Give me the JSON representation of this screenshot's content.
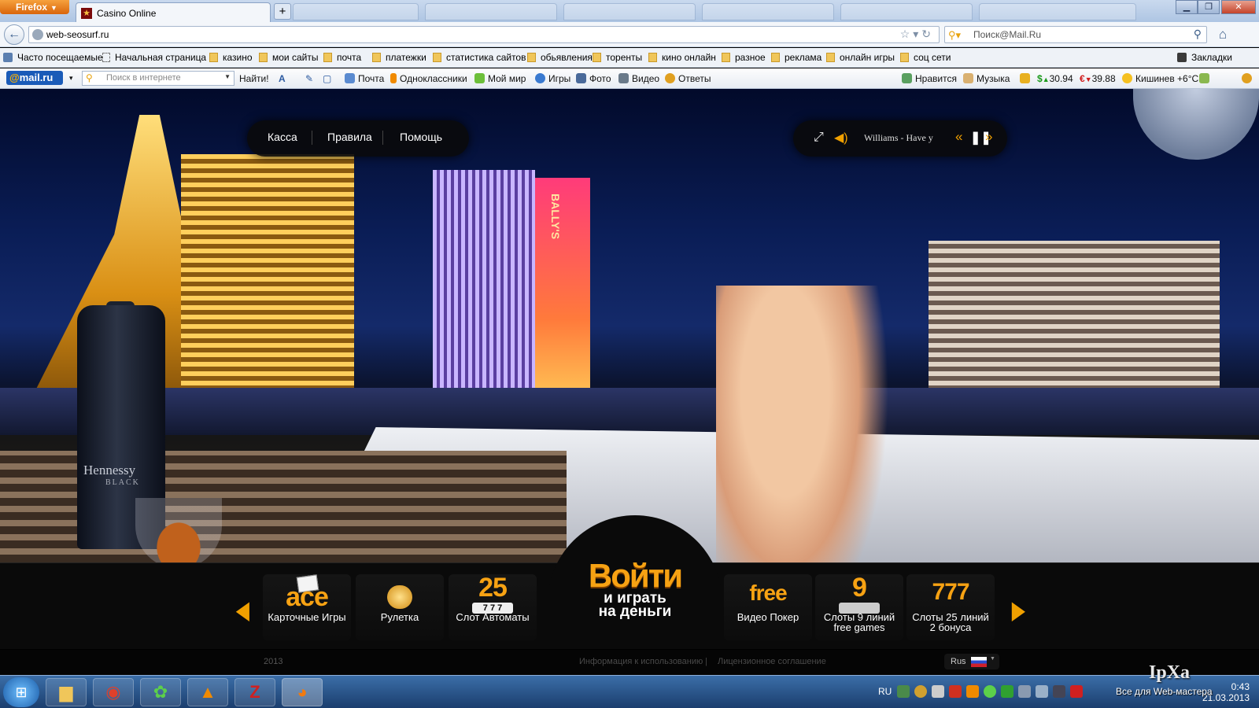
{
  "browser": {
    "menu_button": "Firefox",
    "active_tab": "Casino Online",
    "new_tab": "+",
    "url": "web-seosurf.ru",
    "search_placeholder": "Поиск@Mail.Ru"
  },
  "bookmarks": {
    "items": [
      "Часто посещаемые",
      "Начальная страница",
      "казино",
      "мои сайты",
      "почта",
      "платежки",
      "статистика сайтов",
      "обьявления",
      "торенты",
      "кино онлайн",
      "разное",
      "реклама",
      "онлайн игры",
      "соц сети"
    ],
    "right": "Закладки"
  },
  "mailru_bar": {
    "logo_at": "@",
    "logo_text": "mail.ru",
    "search_placeholder": "Поиск в интернете",
    "find_button": "Найти!",
    "links": [
      "Почта",
      "Одноклассники",
      "Мой мир",
      "Игры",
      "Фото",
      "Видео",
      "Ответы"
    ],
    "likes": "Нравится",
    "music": "Музыка",
    "usd_symbol": "$",
    "usd": "30.94",
    "eur_symbol": "€",
    "eur": "39.88",
    "weather": "Кишинев +6°C"
  },
  "site": {
    "menu": [
      "Касса",
      "Правила",
      "Помощь"
    ],
    "player_track": "Williams - Have y",
    "login_title": "Войти",
    "login_sub_1": "и играть",
    "login_sub_2": "на деньги",
    "games_left": [
      {
        "big": "ace",
        "label": "Карточные Игры"
      },
      {
        "big": "",
        "label": "Рулетка"
      },
      {
        "big": "25",
        "label": "Слот Автоматы"
      }
    ],
    "games_right": [
      {
        "big": "free",
        "label": "Видео Покер"
      },
      {
        "big": "9",
        "label": "Слоты 9 линий",
        "label2": "free games"
      },
      {
        "big": "777",
        "label": "Слоты 25 линий",
        "label2": "2 бонуса"
      }
    ],
    "reels_text": "7 7 7",
    "bottle_text": "Hennessy",
    "bottle_sub": "BLACK",
    "ballys_sign": "BALLY'S",
    "footer_year": "2013",
    "footer_terms": "Информация к использованию",
    "footer_sep": "|",
    "footer_license": "Лицензионное соглашение",
    "lang": "Rus"
  },
  "taskbar": {
    "lang": "RU",
    "time": "0:43",
    "date": "21.03.2013"
  },
  "watermark": {
    "logo": "IpXa",
    "text": "Все для Web-мастера"
  }
}
